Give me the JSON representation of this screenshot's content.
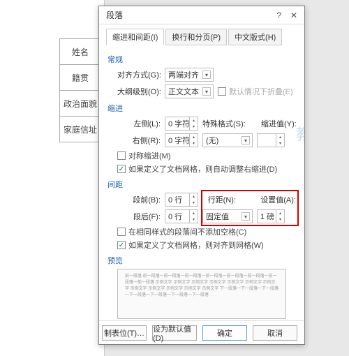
{
  "doc_labels": [
    "姓名",
    "籍贯",
    "政治面貌",
    "家庭信址"
  ],
  "watermark": "教育",
  "dialog": {
    "title": "段落",
    "tabs": [
      "缩进和间距(I)",
      "换行和分页(P)",
      "中文版式(H)"
    ],
    "general": {
      "title": "常规",
      "align_label": "对齐方式(G):",
      "align_value": "两端对齐",
      "outline_label": "大纲级别(O):",
      "outline_value": "正文文本",
      "collapse_label": "默认情况下折叠(E)"
    },
    "indent": {
      "title": "缩进",
      "left_label": "左侧(L):",
      "left_value": "0 字符",
      "right_label": "右侧(R):",
      "right_value": "0 字符",
      "special_label": "特殊格式(S):",
      "special_value": "(无)",
      "ind_val_label": "缩进值(Y):",
      "mirror_label": "对称缩进(M)",
      "grid_label": "如果定义了文档网格，则自动调整右缩进(D)"
    },
    "spacing": {
      "title": "间距",
      "before_label": "段前(B):",
      "before_value": "0 行",
      "after_label": "段后(F):",
      "after_value": "0 行",
      "line_label": "行距(N):",
      "line_value": "固定值",
      "setval_label": "设置值(A):",
      "setval_value": "1 磅",
      "nospace_label": "在相同样式的段落间不添加空格(C)",
      "grid_label": "如果定义了文档网格，则对齐到网格(W)"
    },
    "preview": {
      "title": "预览",
      "text": "前一段落 前一段落一前一段落一前一段落一前一段落一前一段落一前一段落一前一段落一前一段落 示例文字 示例文字 示例文字 示例文字 示例文字 示例文字 示例文字 示例文字 示例文字 示例文字 示例文字 示例文字 下一段落一下一段落一下一段落一下一段落一下一段落一下一段落一下一段落"
    },
    "footer": {
      "tabstops": "制表位(T)…",
      "default": "设为默认值(D)",
      "ok": "确定",
      "cancel": "取消"
    }
  }
}
